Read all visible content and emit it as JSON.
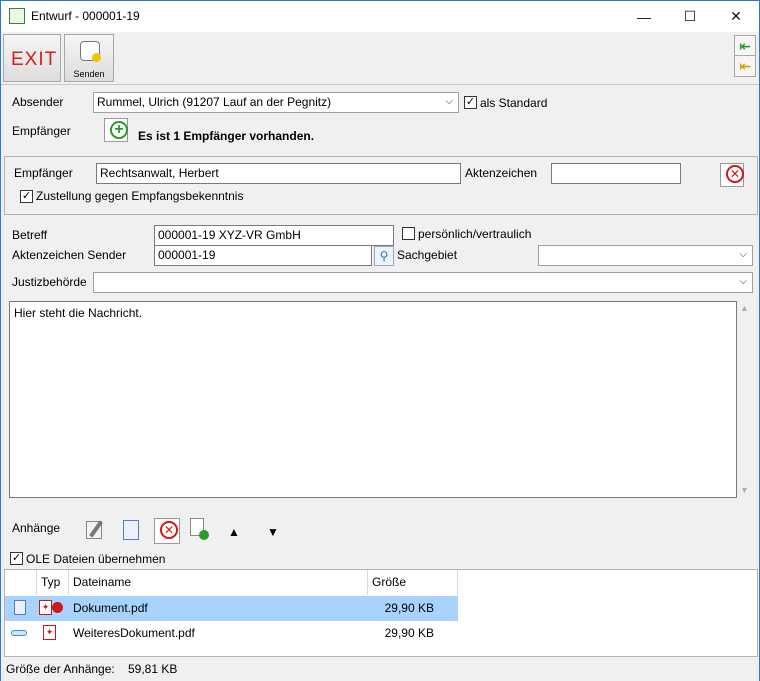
{
  "window": {
    "title": "Entwurf - 000001-19",
    "minimize": "—",
    "maximize": "☐",
    "close": "✕"
  },
  "toolbar": {
    "exit_label": "EXIT",
    "senden_label": "Senden"
  },
  "sender": {
    "absender_label": "Absender",
    "absender_value": "Rummel, Ulrich (91207 Lauf an der Pegnitz)",
    "als_standard_label": "als Standard",
    "als_standard_checked": true,
    "empfaenger_label": "Empfänger",
    "recipient_count_text": "Es ist 1 Empfänger vorhanden."
  },
  "recipient_panel": {
    "empfaenger_label": "Empfänger",
    "empfaenger_value": "Rechtsanwalt, Herbert",
    "aktenzeichen_label": "Aktenzeichen",
    "aktenzeichen_value": "",
    "zustellung_label": "Zustellung gegen Empfangsbekenntnis",
    "zustellung_checked": true
  },
  "message": {
    "betreff_label": "Betreff",
    "betreff_value": "000001-19 XYZ-VR GmbH",
    "persoenlich_label": "persönlich/vertraulich",
    "persoenlich_checked": false,
    "aktenzeichen_sender_label": "Aktenzeichen Sender",
    "aktenzeichen_sender_value": "000001-19",
    "sachgebiet_label": "Sachgebiet",
    "sachgebiet_value": "",
    "justizbehoerde_label": "Justizbehörde",
    "justizbehoerde_value": "",
    "body": "Hier steht die Nachricht."
  },
  "attachments": {
    "label": "Anhänge",
    "ole_label": "OLE Dateien übernehmen",
    "ole_checked": true,
    "columns": [
      "Typ",
      "Dateiname",
      "Größe"
    ],
    "rows": [
      {
        "name": "Dokument.pdf",
        "size": "29,90 KB",
        "selected": true
      },
      {
        "name": "WeiteresDokument.pdf",
        "size": "29,90 KB",
        "selected": false
      }
    ]
  },
  "status": {
    "total_label": "Größe der Anhänge:",
    "total_value": "59,81 KB"
  },
  "colors": {
    "exit_red": "#d21f1f",
    "selection_blue": "#a8d3ff",
    "add_green": "#2a9a2a",
    "remove_red": "#d01818"
  }
}
